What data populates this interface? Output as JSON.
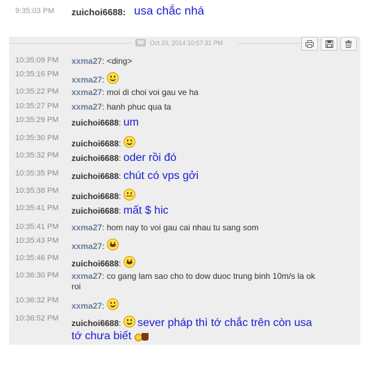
{
  "previous": {
    "time": "9:35:03 PM",
    "sender": "zuichoi6688",
    "text": "usa chắc nhá"
  },
  "session_header": {
    "badge": "IM",
    "date": "Oct 20, 2014 10:57:31 PM",
    "tools": [
      "print-icon",
      "save-icon",
      "delete-icon"
    ]
  },
  "messages": [
    {
      "time": "10:35:09 PM",
      "sender": "xxma27",
      "text": "<ding>",
      "emoticon": ""
    },
    {
      "time": "10:35:16 PM",
      "sender": "xxma27",
      "text": "",
      "emoticon": "smile"
    },
    {
      "time": "10:35:22 PM",
      "sender": "xxma27",
      "text": "moi di choi voi gau ve ha",
      "emoticon": ""
    },
    {
      "time": "10:35:27 PM",
      "sender": "xxma27",
      "text": "hanh phuc qua ta",
      "emoticon": ""
    },
    {
      "time": "10:35:29 PM",
      "sender": "zuichoi6688",
      "text": "um",
      "emoticon": ""
    },
    {
      "time": "10:35:30 PM",
      "sender": "zuichoi6688",
      "text": "",
      "emoticon": "grin"
    },
    {
      "time": "10:35:32 PM",
      "sender": "zuichoi6688",
      "text": "oder rồi đó",
      "emoticon": ""
    },
    {
      "time": "10:35:35 PM",
      "sender": "zuichoi6688",
      "text": "chút có vps gởi",
      "emoticon": ""
    },
    {
      "time": "10:35:38 PM",
      "sender": "zuichoi6688",
      "text": "",
      "emoticon": "straight-face"
    },
    {
      "time": "10:35:41 PM",
      "sender": "zuichoi6688",
      "text": "mất $ hic",
      "emoticon": ""
    },
    {
      "time": "10:35:41 PM",
      "sender": "xxma27",
      "text": "hom nay to voi gau cai nhau tu sang som",
      "emoticon": ""
    },
    {
      "time": "10:35:43 PM",
      "sender": "xxma27",
      "text": "",
      "emoticon": "laugh"
    },
    {
      "time": "10:35:46 PM",
      "sender": "zuichoi6688",
      "text": "",
      "emoticon": "laugh"
    },
    {
      "time": "10:36:30 PM",
      "sender": "xxma27",
      "text": "co gang lam sao cho to dow duoc trung binh 10m/s la ok",
      "text2": "roi",
      "emoticon": ""
    },
    {
      "time": "10:36:32 PM",
      "sender": "xxma27",
      "text": "",
      "emoticon": "smile"
    },
    {
      "time": "10:36:52 PM",
      "sender": "zuichoi6688",
      "text": "sever pháp thì tớ chắc trên còn usa",
      "text2": "tớ chưa biết",
      "emoticon": "grin",
      "trailing_emoticon": "coffee"
    }
  ],
  "colors": {
    "self_message": "#1a1ad6",
    "peer_sender": "#6a7d9a",
    "session_background": "#eeeeee"
  }
}
